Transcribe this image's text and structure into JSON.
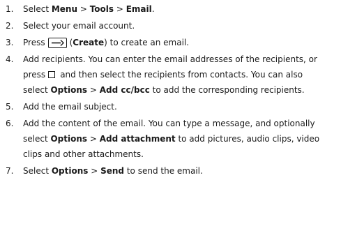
{
  "steps": [
    {
      "num": "1.",
      "parts": [
        "Select ",
        "Menu",
        " > ",
        "Tools",
        " > ",
        "Email",
        "."
      ]
    },
    {
      "num": "2.",
      "text": "Select your email account."
    },
    {
      "num": "3.",
      "before": "Press",
      "icon": "create-key-icon",
      "paren_open": "(",
      "bold": "Create",
      "after": ") to create an email."
    },
    {
      "num": "4.",
      "a": "Add recipients. You can enter the email addresses of the recipients, or press",
      "icon": "square-key-icon",
      "b": "and then select the recipients from contacts. You can also select ",
      "bold1": "Options",
      "sep": " > ",
      "bold2": "Add cc/bcc",
      "c": " to add the corresponding recipients."
    },
    {
      "num": "5.",
      "text": "Add the email subject."
    },
    {
      "num": "6.",
      "a": "Add the content of the email. You can type a message, and optionally select ",
      "bold1": "Options",
      "sep": " > ",
      "bold2": "Add attachment",
      "b": " to add pictures, audio clips, video clips and other attachments."
    },
    {
      "num": "7.",
      "a": "Select ",
      "bold1": "Options",
      "sep": " > ",
      "bold2": "Send",
      "b": " to send the email."
    }
  ]
}
